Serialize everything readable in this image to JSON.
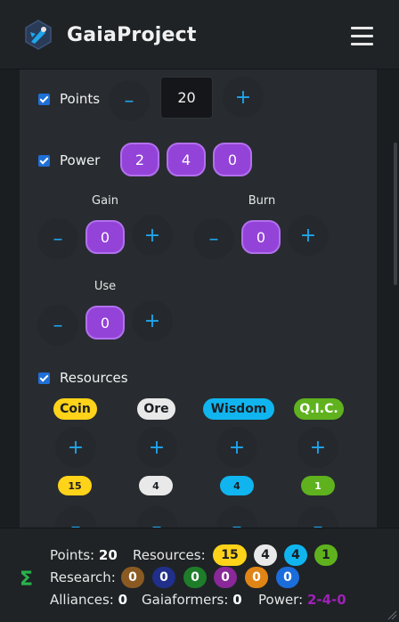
{
  "navbar": {
    "brand": "GaiaProject"
  },
  "points": {
    "label": "Points",
    "value": "20",
    "minus": "–",
    "plus": "+"
  },
  "power": {
    "label": "Power",
    "bowls": [
      "2",
      "4",
      "0"
    ],
    "gain": {
      "label": "Gain",
      "value": "0"
    },
    "burn": {
      "label": "Burn",
      "value": "0"
    },
    "use": {
      "label": "Use",
      "value": "0"
    },
    "minus": "–",
    "plus": "+"
  },
  "resources": {
    "label": "Resources",
    "items": [
      {
        "name": "Coin",
        "count": "15",
        "color": "#ffd319"
      },
      {
        "name": "Ore",
        "count": "4",
        "color": "#e9e9e9"
      },
      {
        "name": "Wisdom",
        "count": "4",
        "color": "#10b5ef"
      },
      {
        "name": "Q.I.C.",
        "count": "1",
        "color": "#5fb21e"
      }
    ],
    "minus": "–",
    "plus": "+"
  },
  "footer": {
    "points_label": "Points:",
    "points_value": "20",
    "resources_label": "Resources:",
    "resources": [
      "15",
      "4",
      "4",
      "1"
    ],
    "research_label": "Research:",
    "research": [
      "0",
      "0",
      "0",
      "0",
      "0",
      "0"
    ],
    "research_colors": [
      "#8a5a22",
      "#1f2f8a",
      "#1e7d29",
      "#8a2799",
      "#e08515",
      "#1b6ddb"
    ],
    "alliances_label": "Alliances:",
    "alliances_value": "0",
    "gaiaformers_label": "Gaiaformers:",
    "gaiaformers_value": "0",
    "power_label": "Power:",
    "power_value": "2-4-0"
  }
}
